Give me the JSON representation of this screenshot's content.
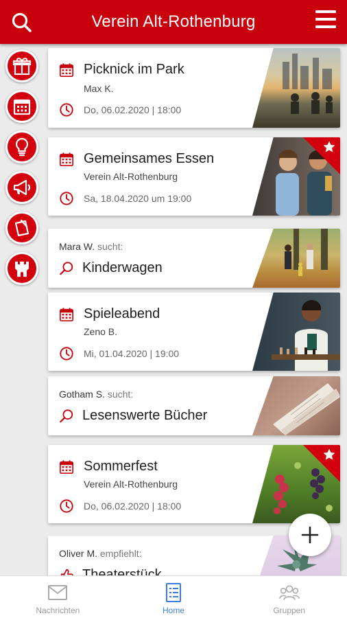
{
  "header": {
    "title": "Verein Alt-Rothenburg"
  },
  "side_categories": [
    {
      "icon": "gift-icon"
    },
    {
      "icon": "calendar-icon"
    },
    {
      "icon": "lightbulb-icon"
    },
    {
      "icon": "megaphone-icon"
    },
    {
      "icon": "notepad-icon"
    },
    {
      "icon": "castle-icon"
    }
  ],
  "feed": [
    {
      "type": "event",
      "title": "Picknick im Park",
      "author": "Max K.",
      "date": "Do, 06.02.2020 | 18:00",
      "featured": false
    },
    {
      "type": "event",
      "title": "Gemeinsames Essen",
      "author": "Verein Alt-Rothenburg",
      "date": "Sa, 18.04.2020 um 19:00",
      "featured": true
    },
    {
      "type": "search",
      "author": "Mara W.",
      "verb": "sucht:",
      "query": "Kinderwagen"
    },
    {
      "type": "event",
      "title": "Spieleabend",
      "author": "Zeno B.",
      "date": "Mi, 01.04.2020 | 19:00",
      "featured": false
    },
    {
      "type": "search",
      "author": "Gotham S.",
      "verb": "sucht:",
      "query": "Lesenswerte Bücher"
    },
    {
      "type": "event",
      "title": "Sommerfest",
      "author": "Verein Alt-Rothenburg",
      "date": "Do, 06.02.2020 | 18:00",
      "featured": true
    },
    {
      "type": "recommend",
      "author": "Oliver M.",
      "verb": "empfiehlt:",
      "query": "Theaterstück"
    }
  ],
  "bottom_nav": {
    "messages_label": "Nachrichten",
    "home_label": "Home",
    "groups_label": "Gruppen",
    "active": "Home"
  },
  "colors": {
    "brand": "#c8000b",
    "active_nav": "#3d7bd8"
  }
}
